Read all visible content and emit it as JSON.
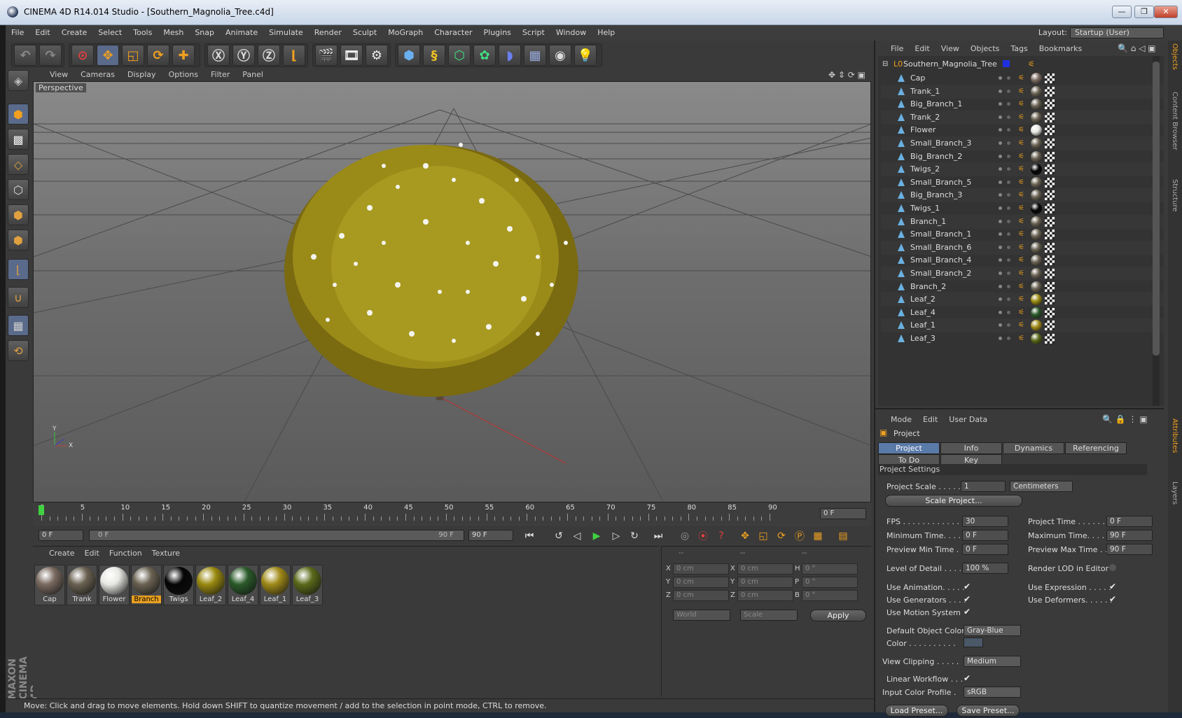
{
  "window": {
    "title": "CINEMA 4D R14.014 Studio - [Southern_Magnolia_Tree.c4d]",
    "min": "—",
    "max": "❐",
    "close": "✕"
  },
  "menu": [
    "File",
    "Edit",
    "Create",
    "Select",
    "Tools",
    "Mesh",
    "Snap",
    "Animate",
    "Simulate",
    "Render",
    "Sculpt",
    "MoGraph",
    "Character",
    "Plugins",
    "Script",
    "Window",
    "Help"
  ],
  "layout": {
    "label": "Layout:",
    "value": "Startup (User)"
  },
  "viewport": {
    "menu": [
      "View",
      "Cameras",
      "Display",
      "Options",
      "Filter",
      "Panel"
    ],
    "label": "Perspective"
  },
  "timeline": {
    "ticks": [
      "0",
      "5",
      "10",
      "15",
      "20",
      "25",
      "30",
      "35",
      "40",
      "45",
      "50",
      "55",
      "60",
      "65",
      "70",
      "75",
      "80",
      "85",
      "90"
    ],
    "current": "0 F"
  },
  "transport": {
    "start": "0 F",
    "range_start": "0 F",
    "range_end": "90 F",
    "end": "90 F"
  },
  "materials": {
    "menu": [
      "Create",
      "Edit",
      "Function",
      "Texture"
    ],
    "items": [
      {
        "name": "Cap",
        "color": "#7a6a60"
      },
      {
        "name": "Trank",
        "color": "#6a6252"
      },
      {
        "name": "Flower",
        "color": "#e8e8e4"
      },
      {
        "name": "Branch",
        "color": "#6a6252",
        "selected": true
      },
      {
        "name": "Twigs",
        "color": "#050505"
      },
      {
        "name": "Leaf_2",
        "color": "#9a8a10"
      },
      {
        "name": "Leaf_4",
        "color": "#2a5a2a"
      },
      {
        "name": "Leaf_1",
        "color": "#a08a18"
      },
      {
        "name": "Leaf_3",
        "color": "#5a6a1a"
      }
    ]
  },
  "coords": {
    "headers": [
      "--",
      "--",
      "--"
    ],
    "rows": [
      {
        "a": "X",
        "av": "0 cm",
        "b": "X",
        "bv": "0 cm",
        "c": "H",
        "cv": "0 °"
      },
      {
        "a": "Y",
        "av": "0 cm",
        "b": "Y",
        "bv": "0 cm",
        "c": "P",
        "cv": "0 °"
      },
      {
        "a": "Z",
        "av": "0 cm",
        "b": "Z",
        "bv": "0 cm",
        "c": "B",
        "cv": "0 °"
      }
    ],
    "world": "World",
    "scale": "Scale",
    "apply": "Apply"
  },
  "status": "Move: Click and drag to move elements. Hold down SHIFT to quantize movement / add to the selection in point mode, CTRL to remove.",
  "brand": "MAXON CINEMA 4D",
  "objects": {
    "menu": [
      "File",
      "Edit",
      "View",
      "Objects",
      "Tags",
      "Bookmarks"
    ],
    "root": "Southern_Magnolia_Tree",
    "items": [
      {
        "name": "Cap",
        "mat": "#7a6a60"
      },
      {
        "name": "Trank_1",
        "mat": "#6a6252"
      },
      {
        "name": "Big_Branch_1",
        "mat": "#6a6252"
      },
      {
        "name": "Trank_2",
        "mat": "#6a6252"
      },
      {
        "name": "Flower",
        "mat": "#e8e8e4"
      },
      {
        "name": "Small_Branch_3",
        "mat": "#6a6252"
      },
      {
        "name": "Big_Branch_2",
        "mat": "#6a6252"
      },
      {
        "name": "Twigs_2",
        "mat": "#050505"
      },
      {
        "name": "Small_Branch_5",
        "mat": "#6a6252"
      },
      {
        "name": "Big_Branch_3",
        "mat": "#6a6252"
      },
      {
        "name": "Twigs_1",
        "mat": "#050505"
      },
      {
        "name": "Branch_1",
        "mat": "#6a6252"
      },
      {
        "name": "Small_Branch_1",
        "mat": "#6a6252"
      },
      {
        "name": "Small_Branch_6",
        "mat": "#6a6252"
      },
      {
        "name": "Small_Branch_4",
        "mat": "#6a6252"
      },
      {
        "name": "Small_Branch_2",
        "mat": "#6a6252"
      },
      {
        "name": "Branch_2",
        "mat": "#6a6252"
      },
      {
        "name": "Leaf_2",
        "mat": "#9a8a10"
      },
      {
        "name": "Leaf_4",
        "mat": "#2a5a2a"
      },
      {
        "name": "Leaf_1",
        "mat": "#a08a18"
      },
      {
        "name": "Leaf_3",
        "mat": "#5a6a1a"
      }
    ]
  },
  "attributes": {
    "menu": [
      "Mode",
      "Edit",
      "User Data"
    ],
    "title": "Project",
    "tabs1": [
      "Project Settings",
      "Info",
      "Dynamics",
      "Referencing"
    ],
    "tabs2": [
      "To Do",
      "Key Interpolation"
    ],
    "section": "Project Settings",
    "project_scale_label": "Project Scale . . . . . .",
    "project_scale": "1",
    "units": "Centimeters",
    "scale_btn": "Scale Project...",
    "fps_label": "FPS . . . . . . . . . . . . . .",
    "fps": "30",
    "project_time_label": "Project Time . . . . . . . .",
    "project_time": "0 F",
    "min_time_label": "Minimum Time. . . . .",
    "min_time": "0 F",
    "max_time_label": "Maximum Time. . . . . .",
    "max_time": "90 F",
    "pmin_label": "Preview Min Time . .",
    "pmin": "0 F",
    "pmax_label": "Preview Max Time . . .",
    "pmax": "90 F",
    "lod_label": "Level of Detail . . . . .",
    "lod": "100 %",
    "render_lod_label": "Render LOD in Editor",
    "use_anim": "Use Animation. . . . .",
    "use_expr": "Use Expression . . . . .",
    "use_gen": "Use Generators . . . .",
    "use_def": "Use Deformers. . . . . .",
    "use_motion": "Use Motion System",
    "def_color_label": "Default Object Color",
    "def_color": "Gray-Blue",
    "color_label": "Color . . . . . . . . . .",
    "color_swatch": "#4a5868",
    "clipping_label": "View Clipping . . . . .",
    "clipping": "Medium",
    "linear_label": "Linear Workflow . . .",
    "icp_label": "Input Color Profile .",
    "icp": "sRGB",
    "load": "Load Preset...",
    "save": "Save Preset..."
  },
  "sidetabs": [
    "Objects",
    "Content Browser",
    "Structure",
    "Attributes",
    "Layers"
  ]
}
